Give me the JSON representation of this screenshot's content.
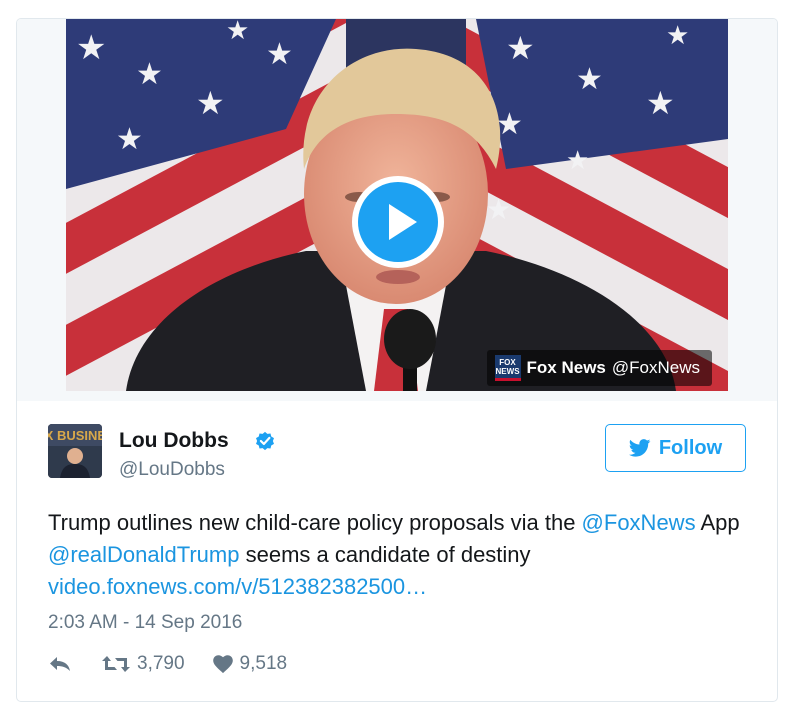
{
  "media": {
    "source_logo_text": "FOX NEWS",
    "source_name": "Fox News",
    "source_handle": "@FoxNews"
  },
  "author": {
    "avatar_text": "FOX BUSINESS",
    "name": "Lou Dobbs",
    "handle": "@LouDobbs",
    "verified": true
  },
  "follow_button": {
    "label": "Follow"
  },
  "tweet": {
    "text_1": "Trump outlines new child-care policy proposals via the ",
    "mention_1": "@FoxNews",
    "text_2": " App ",
    "mention_2": "@realDonaldTrump",
    "text_3": " seems a candidate of destiny ",
    "link": "video.foxnews.com/v/512382382500…",
    "timestamp": "2:03 AM - 14 Sep 2016"
  },
  "stats": {
    "retweets": "3,790",
    "likes": "9,518"
  },
  "colors": {
    "twitter_blue": "#1da1f2",
    "link_blue": "#1b95e0",
    "muted": "#657786",
    "border": "#e1e8ed"
  },
  "icons": {
    "reply": "reply-icon",
    "retweet": "retweet-icon",
    "like": "heart-icon",
    "verified": "verified-badge-icon",
    "bird": "twitter-bird-icon",
    "play": "play-icon"
  }
}
